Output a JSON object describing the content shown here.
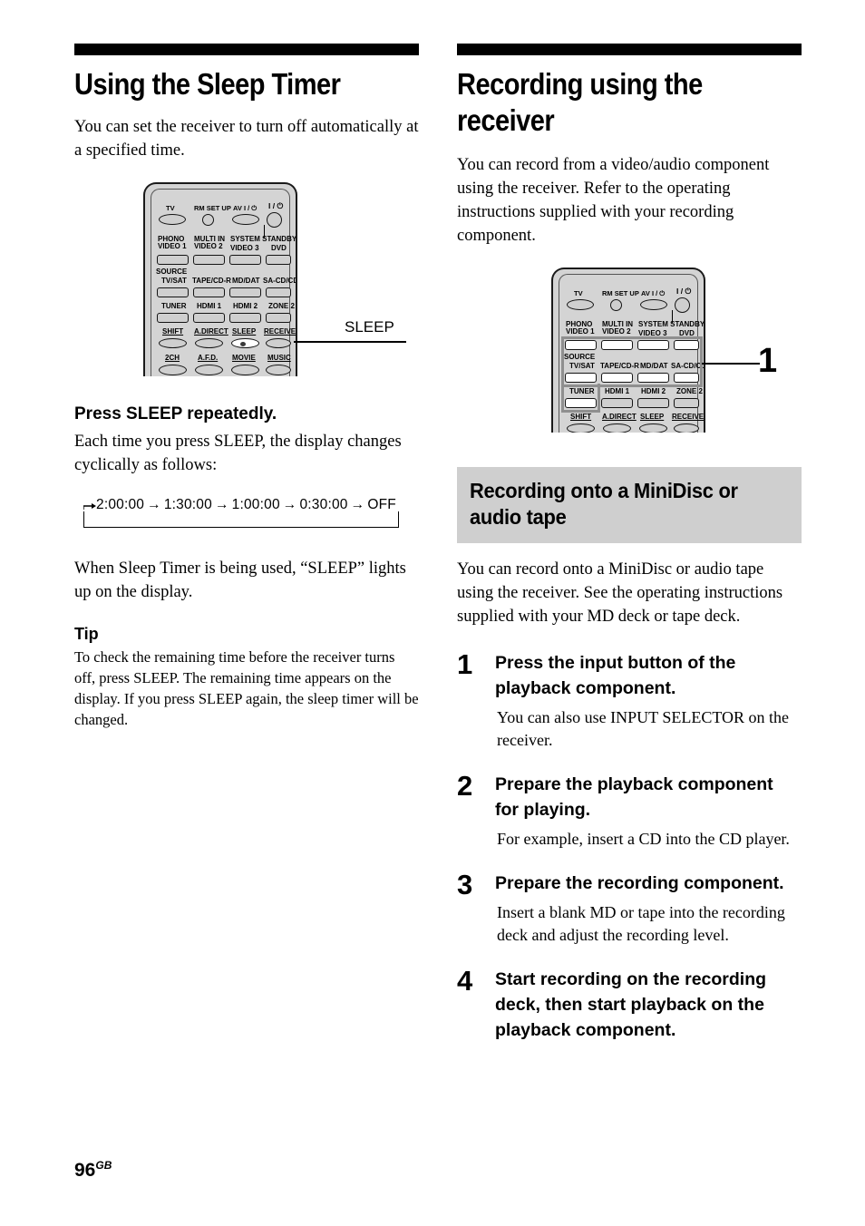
{
  "page": {
    "folio_number": "96",
    "folio_region": "GB"
  },
  "left_column": {
    "title": "Using the Sleep Timer",
    "intro": "You can set the receiver to turn off automatically at a specified time.",
    "remote_callout_label": "SLEEP",
    "instruction_heading": "Press SLEEP repeatedly.",
    "instruction_body": "Each time you press SLEEP, the display changes cyclically as follows:",
    "cycle": {
      "steps": [
        "2:00:00",
        "1:30:00",
        "1:00:00",
        "0:30:00",
        "OFF"
      ],
      "arrow_glyph": "→"
    },
    "after_cycle_text": "When Sleep Timer is being used, “SLEEP” lights up on the display.",
    "tip_heading": "Tip",
    "tip_body": "To check the remaining time before the receiver turns off, press SLEEP. The remaining time appears on the display. If you press SLEEP again, the sleep timer will be changed."
  },
  "right_column": {
    "title": "Recording using the\nreceiver",
    "intro": "You can record from a video/audio component using the receiver. Refer to the operating instructions supplied with your recording component.",
    "remote_callout_number": "1",
    "section_heading": "Recording onto a MiniDisc or\naudio tape",
    "section_intro": "You can record onto a MiniDisc or audio tape using the receiver. See the operating instructions supplied with your MD deck or tape deck.",
    "steps": [
      {
        "number": "1",
        "title": "Press the input button of the playback component.",
        "description": "You can also use INPUT SELECTOR on the receiver."
      },
      {
        "number": "2",
        "title": "Prepare the playback component for playing.",
        "description": "For example, insert a CD into the CD player."
      },
      {
        "number": "3",
        "title": "Prepare the recording component.",
        "description": "Insert a blank MD or tape into the recording deck and adjust the recording level."
      },
      {
        "number": "4",
        "title": "Start recording on the recording deck, then start playback on the playback component.",
        "description": ""
      }
    ]
  },
  "remote_left": {
    "row_top": [
      {
        "label": "TV",
        "shape": "pill"
      },
      {
        "label": "RM SET UP",
        "shape": "circle"
      },
      {
        "label": "AV I / ⏻",
        "shape": "pill"
      },
      {
        "label": "I / ⏻",
        "shape": "circle"
      }
    ],
    "standby_note": "SYSTEM STANDBY",
    "row_video": [
      {
        "label": "PHONO\nVIDEO 1"
      },
      {
        "label": "MULTI IN\nVIDEO 2"
      },
      {
        "label": "VIDEO 3"
      },
      {
        "label": "DVD"
      }
    ],
    "source_label": "SOURCE",
    "row_source": [
      {
        "label": "TV/SAT"
      },
      {
        "label": "TAPE/CD-R"
      },
      {
        "label": "MD/DAT"
      },
      {
        "label": "SA-CD/CD"
      }
    ],
    "row_tuner": [
      {
        "label": "TUNER"
      },
      {
        "label": "HDMI 1"
      },
      {
        "label": "HDMI 2"
      },
      {
        "label": "ZONE 2"
      }
    ],
    "row_shift": [
      {
        "label": "SHIFT"
      },
      {
        "label": "A.DIRECT"
      },
      {
        "label": "SLEEP",
        "highlighted": true
      },
      {
        "label": "RECEIVER"
      }
    ],
    "row_mode": [
      {
        "label": "2CH"
      },
      {
        "label": "A.F.D."
      },
      {
        "label": "MOVIE"
      },
      {
        "label": "MUSIC"
      }
    ]
  },
  "remote_right": {
    "row_top": [
      {
        "label": "TV",
        "shape": "pill"
      },
      {
        "label": "RM SET UP",
        "shape": "circle"
      },
      {
        "label": "AV I / ⏻",
        "shape": "pill"
      },
      {
        "label": "I / ⏻",
        "shape": "circle"
      }
    ],
    "standby_note": "SYSTEM STANDBY",
    "row_video": [
      {
        "label": "PHONO\nVIDEO 1"
      },
      {
        "label": "MULTI IN\nVIDEO 2"
      },
      {
        "label": "VIDEO 3"
      },
      {
        "label": "DVD"
      }
    ],
    "source_label": "SOURCE",
    "row_source": [
      {
        "label": "TV/SAT"
      },
      {
        "label": "TAPE/CD-R"
      },
      {
        "label": "MD/DAT"
      },
      {
        "label": "SA-CD/CD"
      }
    ],
    "row_tuner": [
      {
        "label": "TUNER",
        "highlighted": true
      },
      {
        "label": "HDMI 1"
      },
      {
        "label": "HDMI 2"
      },
      {
        "label": "ZONE 2"
      }
    ],
    "row_shift": [
      {
        "label": "SHIFT"
      },
      {
        "label": "A.DIRECT"
      },
      {
        "label": "SLEEP"
      },
      {
        "label": "RECEIVER"
      }
    ]
  }
}
